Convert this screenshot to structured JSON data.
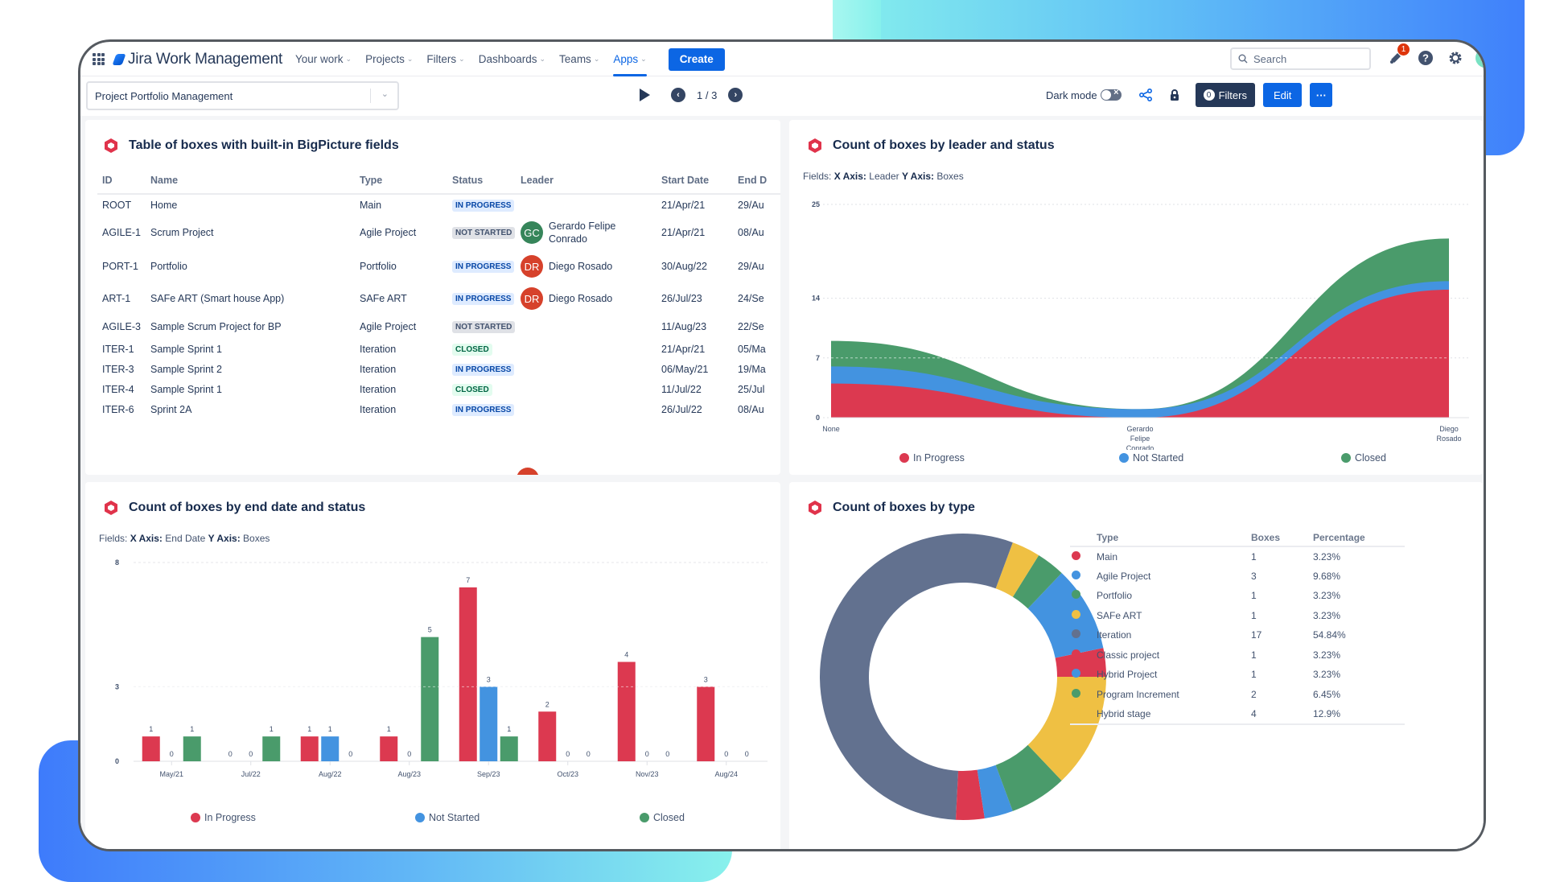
{
  "colors": {
    "in_progress": "#dc3950",
    "not_started": "#4393e0",
    "closed": "#4a9b6b",
    "iteration": "#62718f",
    "yellow": "#efc043",
    "accent": "#0c66e4",
    "hex_icon": "#e0334b"
  },
  "topnav": {
    "app_name": "Jira Work Management",
    "items": [
      {
        "label": "Your work",
        "active": false
      },
      {
        "label": "Projects",
        "active": false
      },
      {
        "label": "Filters",
        "active": false
      },
      {
        "label": "Dashboards",
        "active": false
      },
      {
        "label": "Teams",
        "active": false
      },
      {
        "label": "Apps",
        "active": true
      }
    ],
    "create_label": "Create",
    "search_placeholder": "Search",
    "notification_count": "1",
    "icons": [
      "notification-icon",
      "help-icon",
      "settings-icon",
      "profile-avatar"
    ]
  },
  "toolbar": {
    "project_select_value": "Project Portfolio Management",
    "pager": "1 / 3",
    "dark_mode_label": "Dark mode",
    "dark_mode_on": false,
    "filters_count": "0",
    "filters_label": "Filters",
    "edit_label": "Edit",
    "more_label": "···"
  },
  "table_panel": {
    "title": "Table of boxes with built-in BigPicture fields",
    "columns": [
      "ID",
      "Name",
      "Type",
      "Status",
      "Leader",
      "Start Date",
      "End D"
    ],
    "rows": [
      {
        "id": "ROOT",
        "name": "Home",
        "type": "Main",
        "status": "IN PROGRESS",
        "status_kind": "inprogress",
        "leader": "",
        "leader_initials": "",
        "leader_color": "",
        "start": "21/Apr/21",
        "end": "29/Au"
      },
      {
        "id": "AGILE-1",
        "name": "Scrum Project",
        "type": "Agile Project",
        "status": "NOT STARTED",
        "status_kind": "notstarted",
        "leader": "Gerardo Felipe Conrado",
        "leader_initials": "GC",
        "leader_color": "#36855a",
        "start": "21/Apr/21",
        "end": "08/Au"
      },
      {
        "id": "PORT-1",
        "name": "Portfolio",
        "type": "Portfolio",
        "status": "IN PROGRESS",
        "status_kind": "inprogress",
        "leader": "Diego Rosado",
        "leader_initials": "DR",
        "leader_color": "#d6412b",
        "start": "30/Aug/22",
        "end": "29/Au"
      },
      {
        "id": "ART-1",
        "name": "SAFe ART (Smart house App)",
        "type": "SAFe ART",
        "status": "IN PROGRESS",
        "status_kind": "inprogress",
        "leader": "Diego Rosado",
        "leader_initials": "DR",
        "leader_color": "#d6412b",
        "start": "26/Jul/23",
        "end": "24/Se"
      },
      {
        "id": "AGILE-3",
        "name": "Sample Scrum Project for BP",
        "type": "Agile Project",
        "status": "NOT STARTED",
        "status_kind": "notstarted",
        "leader": "",
        "leader_initials": "",
        "leader_color": "",
        "start": "11/Aug/23",
        "end": "22/Se"
      },
      {
        "id": "ITER-1",
        "name": "Sample Sprint 1",
        "type": "Iteration",
        "status": "CLOSED",
        "status_kind": "closed",
        "leader": "",
        "leader_initials": "",
        "leader_color": "",
        "start": "21/Apr/21",
        "end": "05/Ma"
      },
      {
        "id": "ITER-3",
        "name": "Sample Sprint 2",
        "type": "Iteration",
        "status": "IN PROGRESS",
        "status_kind": "inprogress",
        "leader": "",
        "leader_initials": "",
        "leader_color": "",
        "start": "06/May/21",
        "end": "19/Ma"
      },
      {
        "id": "ITER-4",
        "name": "Sample Sprint 1",
        "type": "Iteration",
        "status": "CLOSED",
        "status_kind": "closed",
        "leader": "",
        "leader_initials": "",
        "leader_color": "",
        "start": "11/Jul/22",
        "end": "25/Jul"
      },
      {
        "id": "ITER-6",
        "name": "Sprint 2A",
        "type": "Iteration",
        "status": "IN PROGRESS",
        "status_kind": "inprogress",
        "leader": "",
        "leader_initials": "",
        "leader_color": "",
        "start": "26/Jul/22",
        "end": "08/Au"
      }
    ]
  },
  "chart_data": [
    {
      "type": "area",
      "stacked": true,
      "title": "Count of boxes by leader and status",
      "fields_prefix": "Fields:",
      "x_axis_label": "X Axis:",
      "x_field": "Leader",
      "y_axis_label": "Y Axis:",
      "y_field": "Boxes",
      "categories": [
        "None",
        "Gerardo Felipe Conrado",
        "Diego Rosado"
      ],
      "series": [
        {
          "name": "In Progress",
          "values": [
            4,
            0,
            15
          ]
        },
        {
          "name": "Not Started",
          "values": [
            2,
            1,
            1
          ]
        },
        {
          "name": "Closed",
          "values": [
            3,
            0,
            5
          ]
        }
      ],
      "yticks": [
        0,
        7,
        14,
        25
      ],
      "ylim": [
        0,
        25
      ],
      "grid": true,
      "legend": "bottom"
    },
    {
      "type": "bar",
      "title": "Count of boxes by end date and status",
      "fields_prefix": "Fields:",
      "x_axis_label": "X Axis:",
      "x_field": "End Date",
      "y_axis_label": "Y Axis:",
      "y_field": "Boxes",
      "categories": [
        "May/21",
        "Jul/22",
        "Aug/22",
        "Aug/23",
        "Sep/23",
        "Oct/23",
        "Nov/23",
        "Aug/24"
      ],
      "series": [
        {
          "name": "In Progress",
          "values": [
            1,
            0,
            1,
            1,
            7,
            2,
            4,
            3
          ]
        },
        {
          "name": "Not Started",
          "values": [
            0,
            0,
            1,
            0,
            3,
            0,
            0,
            0
          ]
        },
        {
          "name": "Closed",
          "values": [
            1,
            1,
            0,
            5,
            1,
            0,
            0,
            0
          ]
        }
      ],
      "yticks": [
        0,
        3,
        8
      ],
      "ylim": [
        0,
        8
      ],
      "grid": true,
      "legend": "bottom"
    },
    {
      "type": "pie",
      "donut": true,
      "title": "Count of boxes by type",
      "columns": [
        "Type",
        "Boxes",
        "Percentage"
      ],
      "slices": [
        {
          "label": "Main",
          "value": 1,
          "percent": "3.23%",
          "color": "#dc3950"
        },
        {
          "label": "Agile Project",
          "value": 3,
          "percent": "9.68%",
          "color": "#4393e0"
        },
        {
          "label": "Portfolio",
          "value": 1,
          "percent": "3.23%",
          "color": "#4a9b6b"
        },
        {
          "label": "SAFe ART",
          "value": 1,
          "percent": "3.23%",
          "color": "#efc043"
        },
        {
          "label": "Iteration",
          "value": 17,
          "percent": "54.84%",
          "color": "#62718f"
        },
        {
          "label": "Classic project",
          "value": 1,
          "percent": "3.23%",
          "color": "#dc3950"
        },
        {
          "label": "Hybrid Project",
          "value": 1,
          "percent": "3.23%",
          "color": "#4393e0"
        },
        {
          "label": "Program Increment",
          "value": 2,
          "percent": "6.45%",
          "color": "#4a9b6b"
        },
        {
          "label": "Hybrid stage",
          "value": 4,
          "percent": "12.9%",
          "color": "#efc043"
        }
      ],
      "legend": "right"
    }
  ]
}
